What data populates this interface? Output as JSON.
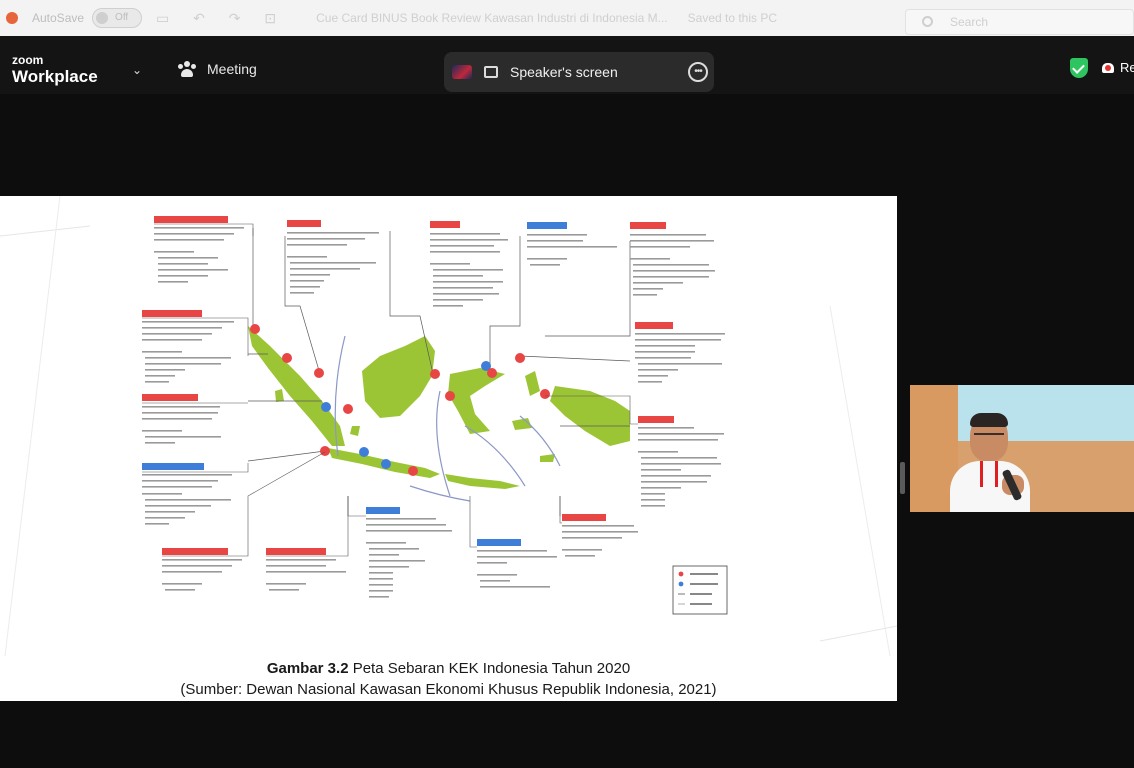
{
  "word_bar": {
    "autosave": "AutoSave",
    "toggle": "Off",
    "doc_title": "Cue Card BINUS Book Review Kawasan Industri di Indonesia M...",
    "saved": "Saved to this PC",
    "search_placeholder": "Search"
  },
  "zoom": {
    "brand_small": "zoom",
    "brand_big": "Workplace",
    "meeting_label": "Meeting",
    "speaker_label": "Speaker's screen",
    "rec_label": "Re"
  },
  "colors": {
    "zoom_header": "#141414",
    "background": "#0d0d0d",
    "security_green": "#2ec45f",
    "map_land": "#9cc536",
    "kek_red": "#e84545",
    "kek_blue": "#3f7ed8"
  },
  "icons": [
    "chevron-down-icon",
    "meeting-icon",
    "monitor-icon",
    "more-icon",
    "shield-icon",
    "record-icon",
    "search-icon"
  ],
  "slide": {
    "caption_bold": "Gambar 3.2",
    "caption_text": " Peta Sebaran KEK Indonesia Tahun 2020",
    "source": "(Sumber: Dewan Nasional Kawasan Ekonomi Khusus Republik Indonesia, 2021)"
  }
}
